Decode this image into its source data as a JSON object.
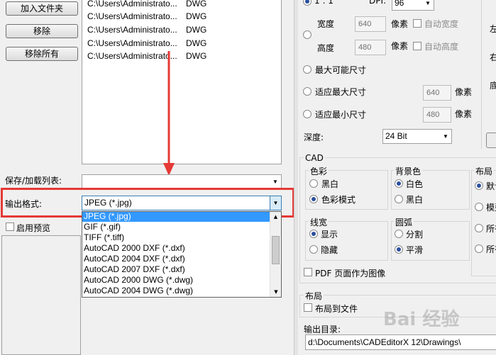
{
  "left_panel": {
    "buttons": {
      "add_file": "加入文件夹",
      "remove": "移除",
      "remove_all": "移除所有"
    },
    "files": [
      {
        "path": "C:\\Users\\Administrato...",
        "type": "DWG"
      },
      {
        "path": "C:\\Users\\Administrato...",
        "type": "DWG"
      },
      {
        "path": "C:\\Users\\Administrato...",
        "type": "DWG"
      },
      {
        "path": "C:\\Users\\Administrato...",
        "type": "DWG"
      },
      {
        "path": "C:\\Users\\Administrato...",
        "type": "DWG"
      }
    ],
    "save_load_label": "保存/加载列表:",
    "output_format_label": "输出格式:",
    "output_format_value": "JPEG (*.jpg)",
    "format_options": [
      "JPEG (*.jpg)",
      "GIF (*.gif)",
      "TIFF (*.tiff)",
      "AutoCAD 2000 DXF (*.dxf)",
      "AutoCAD 2004 DXF (*.dxf)",
      "AutoCAD 2007 DXF (*.dxf)",
      "AutoCAD 2000 DWG (*.dwg)",
      "AutoCAD 2004 DWG (*.dwg)"
    ],
    "enable_preview": "启用预览"
  },
  "size_panel": {
    "ratio_label": "1 : 1",
    "dpi_label": "DPI:",
    "dpi_value": "96",
    "width_label": "宽度",
    "width_value": "640",
    "height_label": "高度",
    "height_value": "480",
    "pixels": "像素",
    "auto_width": "自动宽度",
    "auto_height": "自动高度",
    "max_size": "最大可能尺寸",
    "fit_max": "适应最大尺寸",
    "fit_max_value": "640",
    "fit_min": "适应最小尺寸",
    "fit_min_value": "480",
    "depth_label": "深度:",
    "depth_value": "24 Bit"
  },
  "right_edge": {
    "c1": "左",
    "c2": "右",
    "c3": "底"
  },
  "cad": {
    "title": "CAD",
    "color": {
      "title": "色彩",
      "bw": "黑白",
      "color_mode": "色彩模式"
    },
    "background": {
      "title": "背景色",
      "white": "白色",
      "bw": "黑白"
    },
    "layout": {
      "title": "布局",
      "o1": "默认",
      "o2": "模型",
      "o3": "所有",
      "o4": "所有"
    },
    "lineweight": {
      "title": "线宽",
      "show": "显示",
      "hide": "隐藏"
    },
    "arc": {
      "title": "圆弧",
      "split": "分割",
      "smooth": "平滑"
    },
    "pdf_as_image": "PDF 页面作为图像"
  },
  "layout_section": {
    "title": "布局",
    "layout_to_file": "布局到文件"
  },
  "output_dir": {
    "label": "输出目录:",
    "value": "d:\\Documents\\CADEditorX 12\\Drawings\\"
  },
  "watermark": "Bai 经验",
  "colors": {
    "highlight": "#e53935",
    "selection": "#3399ff"
  }
}
